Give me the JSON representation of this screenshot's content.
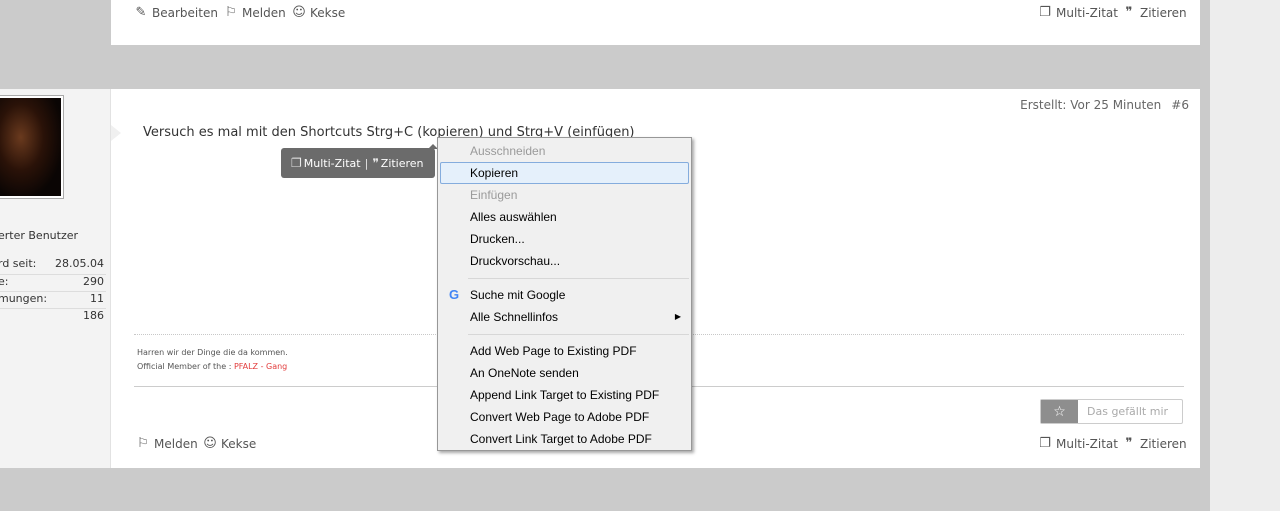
{
  "top_post": {
    "actions_left": [
      {
        "icon": "pencil-icon",
        "glyph": "✎",
        "label": "Bearbeiten"
      },
      {
        "icon": "report-icon",
        "glyph": "⚐",
        "label": "Melden"
      },
      {
        "icon": "cookie-icon",
        "glyph": "☺",
        "label": "Kekse"
      }
    ],
    "actions_right": [
      {
        "icon": "multi-quote-icon",
        "glyph": "❐",
        "label": "Multi-Zitat"
      },
      {
        "icon": "quote-icon",
        "glyph": "❞",
        "label": "Zitieren"
      }
    ]
  },
  "user": {
    "rank": "erter Benutzer",
    "stats": [
      {
        "label": "rd seit:",
        "value": "28.05.04"
      },
      {
        "label": "e:",
        "value": "290"
      },
      {
        "label": "mungen:",
        "value": "11"
      },
      {
        "label": "",
        "value": "186"
      }
    ]
  },
  "post": {
    "created": "Erstellt: Vor 25 Minuten",
    "number": "#6",
    "text": "Versuch es mal mit den Shortcuts Strg+C (kopieren) und Strg+V (einfügen)",
    "signature_line1": "Harren wir der Dinge die da kommen.",
    "signature_line2_prefix": "Official Member of the : ",
    "signature_line2_red": "PFALZ - Gang",
    "like_label": "Das gefällt mir",
    "actions_left": [
      {
        "icon": "report-icon",
        "glyph": "⚐",
        "label": "Melden"
      },
      {
        "icon": "cookie-icon",
        "glyph": "☺",
        "label": "Kekse"
      }
    ],
    "actions_right": [
      {
        "icon": "multi-quote-icon",
        "glyph": "❐",
        "label": "Multi-Zitat"
      },
      {
        "icon": "quote-icon",
        "glyph": "❞",
        "label": "Zitieren"
      }
    ]
  },
  "quote_popup": {
    "multi_label": "Multi-Zitat",
    "separator": "|",
    "quote_label": "Zitieren"
  },
  "context_menu": {
    "items": [
      {
        "label": "Ausschneiden",
        "state": "disabled"
      },
      {
        "label": "Kopieren",
        "state": "selected"
      },
      {
        "label": "Einfügen",
        "state": "disabled"
      },
      {
        "label": "Alles auswählen",
        "state": "normal"
      },
      {
        "label": "Drucken...",
        "state": "normal"
      },
      {
        "label": "Druckvorschau...",
        "state": "normal"
      },
      {
        "label": "Suche mit Google",
        "state": "normal",
        "icon": "google-icon",
        "icon_glyph": "G"
      },
      {
        "label": "Alle Schnellinfos",
        "state": "normal",
        "submenu_glyph": "▶"
      },
      {
        "label": "Add Web Page to Existing PDF",
        "state": "normal"
      },
      {
        "label": "An OneNote senden",
        "state": "normal"
      },
      {
        "label": "Append Link Target to Existing PDF",
        "state": "normal"
      },
      {
        "label": "Convert Web Page to Adobe PDF",
        "state": "normal"
      },
      {
        "label": "Convert Link Target to Adobe PDF",
        "state": "normal"
      }
    ]
  }
}
